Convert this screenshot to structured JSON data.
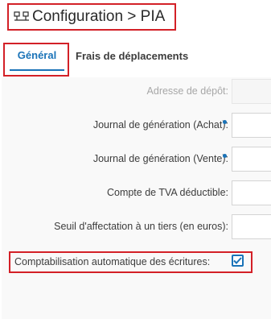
{
  "header": {
    "title": "Configuration > PIA",
    "icon": "network-config-icon"
  },
  "tabs": [
    {
      "label": "Général",
      "active": true
    },
    {
      "label": "Frais de déplacements",
      "active": false
    }
  ],
  "form": {
    "fields": [
      {
        "label": "Adresse de dépôt:",
        "required": false,
        "disabled": true,
        "value": ""
      },
      {
        "label": "Journal de génération (Achat):",
        "required": true,
        "disabled": false,
        "value": ""
      },
      {
        "label": "Journal de génération (Vente):",
        "required": true,
        "disabled": false,
        "value": ""
      },
      {
        "label": "Compte de TVA déductible:",
        "required": false,
        "disabled": false,
        "value": ""
      },
      {
        "label": "Seuil d'affectation à un tiers (en euros):",
        "required": false,
        "disabled": false,
        "value": ""
      }
    ],
    "auto_accounting": {
      "label": "Comptabilisation automatique des écritures:",
      "checked": true
    }
  },
  "colors": {
    "accent": "#1a73b8",
    "highlight": "#d32027"
  }
}
